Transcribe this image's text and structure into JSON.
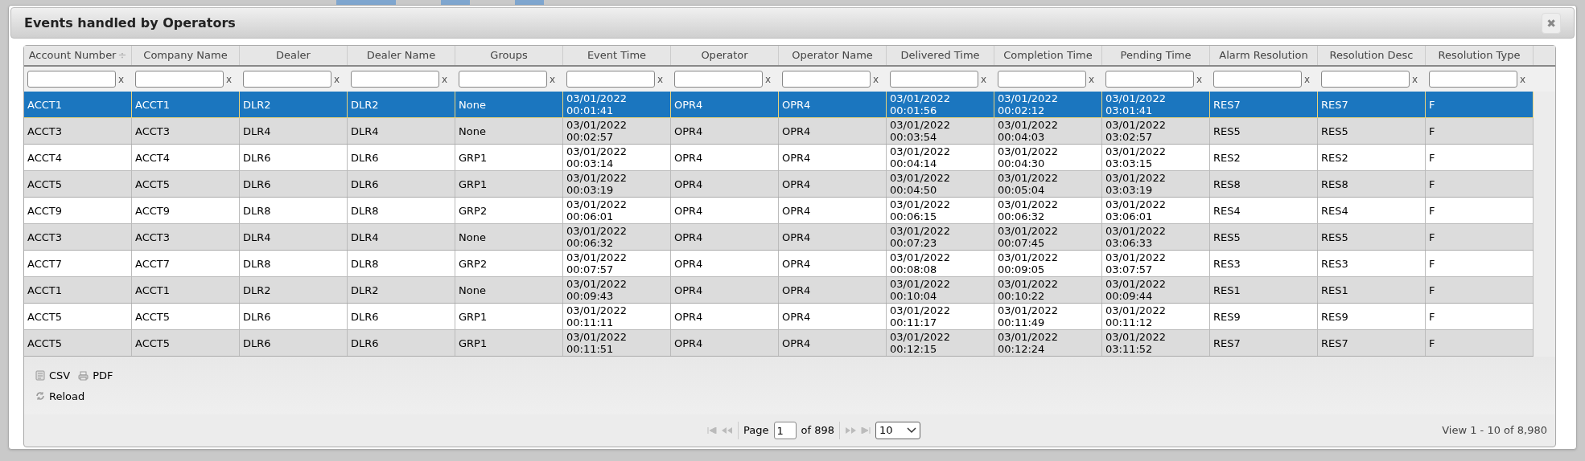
{
  "dialog": {
    "title": "Events handled by Operators",
    "close": "✖"
  },
  "table": {
    "columns": [
      {
        "label": "Account Number",
        "clear": "x"
      },
      {
        "label": "Company Name",
        "clear": "x"
      },
      {
        "label": "Dealer",
        "clear": "x"
      },
      {
        "label": "Dealer Name",
        "clear": "x"
      },
      {
        "label": "Groups",
        "clear": "x"
      },
      {
        "label": "Event Time",
        "clear": "x"
      },
      {
        "label": "Operator",
        "clear": "x"
      },
      {
        "label": "Operator Name",
        "clear": "x"
      },
      {
        "label": "Delivered Time",
        "clear": "x"
      },
      {
        "label": "Completion Time",
        "clear": "x"
      },
      {
        "label": "Pending Time",
        "clear": "x"
      },
      {
        "label": "Alarm Resolution",
        "clear": "x"
      },
      {
        "label": "Resolution Desc",
        "clear": "x"
      },
      {
        "label": "Resolution Type",
        "clear": "x"
      }
    ],
    "sort_mark": "÷",
    "rows": [
      {
        "selected": true,
        "cells": [
          "ACCT1",
          "ACCT1",
          "DLR2",
          "DLR2",
          "None",
          "03/01/2022\n00:01:41",
          "OPR4",
          "OPR4",
          "03/01/2022\n00:01:56",
          "03/01/2022\n00:02:12",
          "03/01/2022\n03:01:41",
          "RES7",
          "RES7",
          "F"
        ]
      },
      {
        "selected": false,
        "cells": [
          "ACCT3",
          "ACCT3",
          "DLR4",
          "DLR4",
          "None",
          "03/01/2022\n00:02:57",
          "OPR4",
          "OPR4",
          "03/01/2022\n00:03:54",
          "03/01/2022\n00:04:03",
          "03/01/2022\n03:02:57",
          "RES5",
          "RES5",
          "F"
        ]
      },
      {
        "selected": false,
        "cells": [
          "ACCT4",
          "ACCT4",
          "DLR6",
          "DLR6",
          "GRP1",
          "03/01/2022\n00:03:14",
          "OPR4",
          "OPR4",
          "03/01/2022\n00:04:14",
          "03/01/2022\n00:04:30",
          "03/01/2022\n03:03:15",
          "RES2",
          "RES2",
          "F"
        ]
      },
      {
        "selected": false,
        "cells": [
          "ACCT5",
          "ACCT5",
          "DLR6",
          "DLR6",
          "GRP1",
          "03/01/2022\n00:03:19",
          "OPR4",
          "OPR4",
          "03/01/2022\n00:04:50",
          "03/01/2022\n00:05:04",
          "03/01/2022\n03:03:19",
          "RES8",
          "RES8",
          "F"
        ]
      },
      {
        "selected": false,
        "cells": [
          "ACCT9",
          "ACCT9",
          "DLR8",
          "DLR8",
          "GRP2",
          "03/01/2022\n00:06:01",
          "OPR4",
          "OPR4",
          "03/01/2022\n00:06:15",
          "03/01/2022\n00:06:32",
          "03/01/2022\n03:06:01",
          "RES4",
          "RES4",
          "F"
        ]
      },
      {
        "selected": false,
        "cells": [
          "ACCT3",
          "ACCT3",
          "DLR4",
          "DLR4",
          "None",
          "03/01/2022\n00:06:32",
          "OPR4",
          "OPR4",
          "03/01/2022\n00:07:23",
          "03/01/2022\n00:07:45",
          "03/01/2022\n03:06:33",
          "RES5",
          "RES5",
          "F"
        ]
      },
      {
        "selected": false,
        "cells": [
          "ACCT7",
          "ACCT7",
          "DLR8",
          "DLR8",
          "GRP2",
          "03/01/2022\n00:07:57",
          "OPR4",
          "OPR4",
          "03/01/2022\n00:08:08",
          "03/01/2022\n00:09:05",
          "03/01/2022\n03:07:57",
          "RES3",
          "RES3",
          "F"
        ]
      },
      {
        "selected": false,
        "cells": [
          "ACCT1",
          "ACCT1",
          "DLR2",
          "DLR2",
          "None",
          "03/01/2022\n00:09:43",
          "OPR4",
          "OPR4",
          "03/01/2022\n00:10:04",
          "03/01/2022\n00:10:22",
          "03/01/2022\n00:09:44",
          "RES1",
          "RES1",
          "F"
        ]
      },
      {
        "selected": false,
        "cells": [
          "ACCT5",
          "ACCT5",
          "DLR6",
          "DLR6",
          "GRP1",
          "03/01/2022\n00:11:11",
          "OPR4",
          "OPR4",
          "03/01/2022\n00:11:17",
          "03/01/2022\n00:11:49",
          "03/01/2022\n00:11:12",
          "RES9",
          "RES9",
          "F"
        ]
      },
      {
        "selected": false,
        "cells": [
          "ACCT5",
          "ACCT5",
          "DLR6",
          "DLR6",
          "GRP1",
          "03/01/2022\n00:11:51",
          "OPR4",
          "OPR4",
          "03/01/2022\n00:12:15",
          "03/01/2022\n00:12:24",
          "03/01/2022\n03:11:52",
          "RES7",
          "RES7",
          "F"
        ]
      }
    ]
  },
  "toolbar": [
    {
      "kind": "csv",
      "label": "CSV"
    },
    {
      "kind": "pdf",
      "label": "PDF"
    }
  ],
  "reload": "Reload",
  "pager": {
    "page_label": "Page",
    "page": "1",
    "of_label": "of 898",
    "page_size": "10",
    "view": "View 1 - 10 of 8,980"
  }
}
